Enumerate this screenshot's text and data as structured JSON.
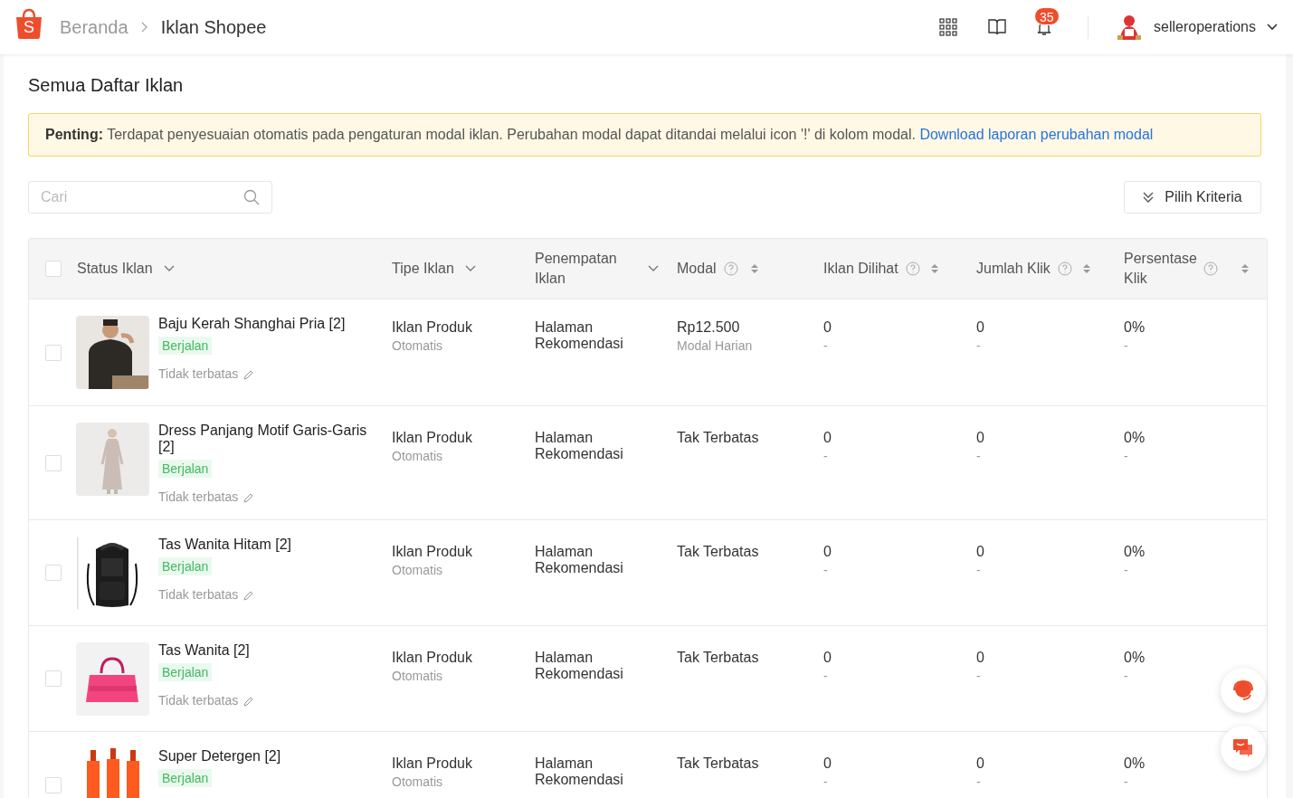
{
  "header": {
    "brand_mark": "S",
    "breadcrumb": [
      "Beranda",
      "Iklan Shopee"
    ],
    "notification_count": "35",
    "username": "selleroperations"
  },
  "page_title": "Semua Daftar Iklan",
  "notice": {
    "message": "**Penting:** Terdapat penyesuaian otomatis pada pengaturan modal iklan. Perubahan modal dapat ditandai melalui icon '!' di kolom modal.",
    "link": "Download laporan perubahan modal"
  },
  "search": {
    "placeholder": "Cari"
  },
  "filter_button": "Pilih Kriteria",
  "table": {
    "select_all_checked": false,
    "columns": [
      {
        "label": "Status Iklan",
        "kind": "dropdown"
      },
      {
        "label": "Tipe Iklan",
        "kind": "dropdown"
      },
      {
        "label": "Penempatan Iklan",
        "kind": "dropdown"
      },
      {
        "label": "Modal",
        "kind": "sort"
      },
      {
        "label": "Iklan Dilihat",
        "kind": "sort"
      },
      {
        "label": "Jumlah Klik",
        "kind": "sort"
      },
      {
        "label": "Persentase Klik",
        "kind": "sort"
      }
    ],
    "rows": [
      {
        "checked": false,
        "product": "Baju Kerah Shanghai Pria [2]",
        "status": "Berjalan",
        "budget": "Tidak terbatas",
        "type": "Iklan Produk",
        "type_mode": "Otomatis",
        "placement": "Halaman Rekomendasi",
        "modal": "Rp12.500",
        "modal_note": "Modal Harian",
        "views": "0",
        "views_note": "-",
        "clicks": "0",
        "clicks_note": "-",
        "ctr": "0%",
        "ctr_note": "-"
      },
      {
        "checked": false,
        "product": "Dress Panjang Motif Garis-Garis [2]",
        "status": "Berjalan",
        "budget": "Tidak terbatas",
        "type": "Iklan Produk",
        "type_mode": "Otomatis",
        "placement": "Halaman Rekomendasi",
        "modal": "Tak Terbatas",
        "views": "0",
        "views_note": "-",
        "clicks": "0",
        "clicks_note": "-",
        "ctr": "0%",
        "ctr_note": "-"
      },
      {
        "checked": false,
        "product": "Tas Wanita Hitam [2]",
        "status": "Berjalan",
        "budget": "Tidak terbatas",
        "type": "Iklan Produk",
        "type_mode": "Otomatis",
        "placement": "Halaman Rekomendasi",
        "modal": "Tak Terbatas",
        "views": "0",
        "views_note": "-",
        "clicks": "0",
        "clicks_note": "-",
        "ctr": "0%",
        "ctr_note": "-"
      },
      {
        "checked": false,
        "product": "Tas Wanita [2]",
        "status": "Berjalan",
        "budget": "Tidak terbatas",
        "type": "Iklan Produk",
        "type_mode": "Otomatis",
        "placement": "Halaman Rekomendasi",
        "modal": "Tak Terbatas",
        "views": "0",
        "views_note": "-",
        "clicks": "0",
        "clicks_note": "-",
        "ctr": "0%",
        "ctr_note": "-"
      },
      {
        "checked": false,
        "product": "Super Detergen [2]",
        "status": "Berjalan",
        "type": "Iklan Produk",
        "type_mode": "Otomatis",
        "placement": "Halaman Rekomendasi",
        "modal": "Tak Terbatas",
        "views": "0",
        "views_note": "-",
        "clicks": "0",
        "clicks_note": "-",
        "ctr": "0%",
        "ctr_note": "-"
      }
    ]
  }
}
